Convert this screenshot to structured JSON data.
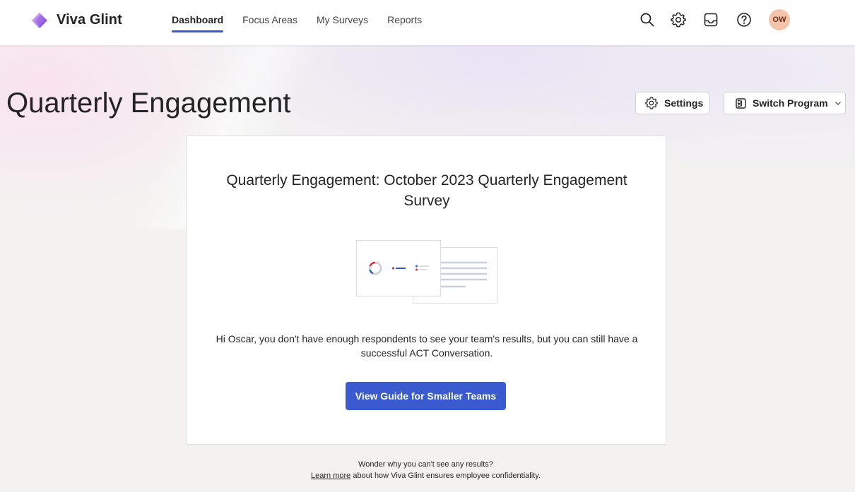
{
  "app": {
    "brand": "Viva Glint"
  },
  "nav": {
    "items": [
      {
        "label": "Dashboard",
        "active": true
      },
      {
        "label": "Focus Areas",
        "active": false
      },
      {
        "label": "My Surveys",
        "active": false
      },
      {
        "label": "Reports",
        "active": false
      }
    ]
  },
  "toolbar_icons": [
    "search-icon",
    "gear-icon",
    "inbox-icon",
    "help-icon"
  ],
  "user": {
    "initials": "OW"
  },
  "page": {
    "title": "Quarterly Engagement",
    "settings_label": "Settings",
    "switch_program_label": "Switch Program"
  },
  "card": {
    "title": "Quarterly Engagement: October 2023 Quarterly Engagement Survey",
    "message": "Hi Oscar, you don't have enough respondents to see your team's results, but you can still have a successful ACT Conversation.",
    "button_label": "View Guide for Smaller Teams"
  },
  "footer": {
    "line1": "Wonder why you can't see any results?",
    "link": "Learn more",
    "line2_rest": "about how Viva Glint ensures employee confidentiality."
  },
  "colors": {
    "accent": "#3a5bd0",
    "avatar_bg": "#f4c4aa",
    "logo": "#8b5cf6"
  }
}
